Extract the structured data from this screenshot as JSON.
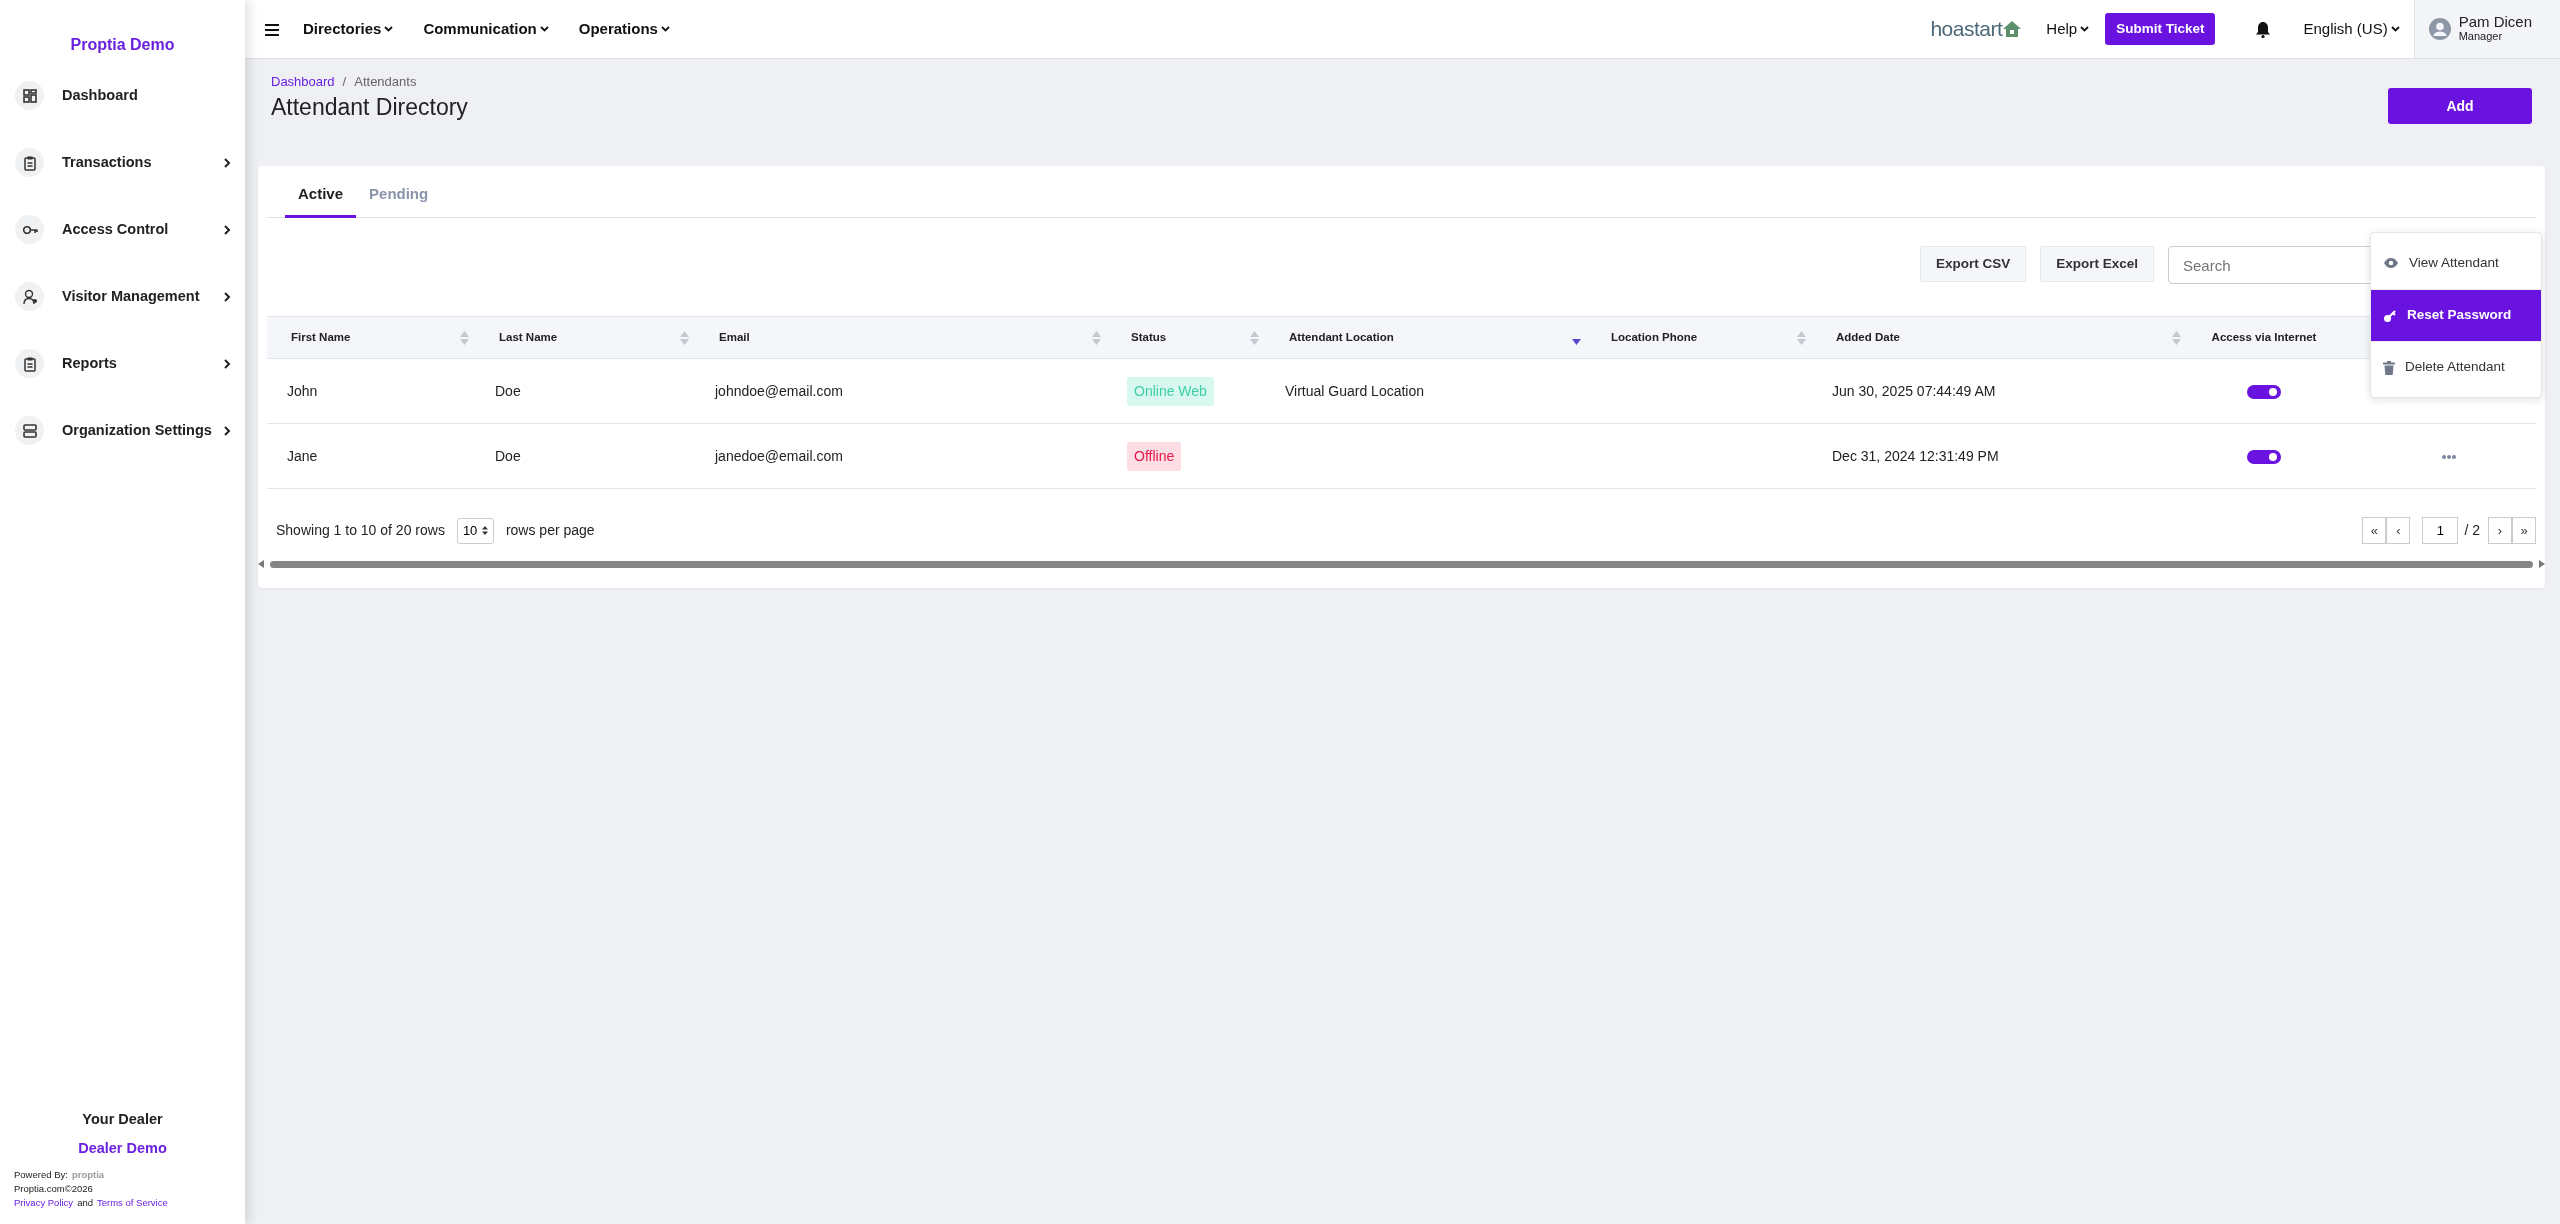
{
  "sidebar": {
    "brand": "Proptia Demo",
    "items": [
      {
        "label": "Dashboard",
        "has_submenu": false
      },
      {
        "label": "Transactions",
        "has_submenu": true
      },
      {
        "label": "Access Control",
        "has_submenu": true
      },
      {
        "label": "Visitor Management",
        "has_submenu": true
      },
      {
        "label": "Reports",
        "has_submenu": true
      },
      {
        "label": "Organization Settings",
        "has_submenu": true
      }
    ],
    "footer": {
      "heading": "Your Dealer",
      "dealer": "Dealer Demo",
      "powered_by": "Powered By:",
      "powered_logo": "proptia",
      "copyright": "Proptia.com©2026",
      "privacy": "Privacy Policy",
      "and": "and",
      "terms": "Terms of Service"
    }
  },
  "topbar": {
    "menus": [
      "Directories",
      "Communication",
      "Operations"
    ],
    "logo": "hoastart",
    "help": "Help",
    "submit_ticket": "Submit Ticket",
    "language": "English (US)",
    "user": {
      "name": "Pam Dicen",
      "role": "Manager"
    }
  },
  "breadcrumb": {
    "items": [
      "Dashboard",
      "Attendants"
    ],
    "separator": "/"
  },
  "title": "Attendant Directory",
  "add_button": "Add",
  "tabs": [
    {
      "label": "Active",
      "selected": true
    },
    {
      "label": "Pending",
      "selected": false
    }
  ],
  "toolbar": {
    "buttons": [
      "Export CSV",
      "Export Excel"
    ],
    "search": {
      "placeholder": "Search"
    }
  },
  "table": {
    "columns": [
      {
        "label": "First Name",
        "sortable": true,
        "sorted": false
      },
      {
        "label": "Last Name",
        "sortable": true,
        "sorted": false
      },
      {
        "label": "Email",
        "sortable": true,
        "sorted": false
      },
      {
        "label": "Status",
        "sortable": true,
        "sorted": false
      },
      {
        "label": "Attendant Location",
        "sortable": true,
        "sorted": true
      },
      {
        "label": "Location Phone",
        "sortable": true,
        "sorted": false
      },
      {
        "label": "Added Date",
        "sortable": true,
        "sorted": false
      },
      {
        "label": "Access via Internet",
        "sortable": false
      }
    ],
    "rows": [
      {
        "first_name": "John",
        "last_name": "Doe",
        "email": "johndoe@email.com",
        "status": {
          "label": "Online Web",
          "kind": "online"
        },
        "location": "Virtual Guard Location",
        "added": "Jun 30, 2025 07:44:49 AM",
        "access": true,
        "menu_open": true
      },
      {
        "first_name": "Jane",
        "last_name": "Doe",
        "email": "janedoe@email.com",
        "status": {
          "label": "Offline",
          "kind": "offline"
        },
        "added": "Dec 31, 2024 12:31:49 PM",
        "access": true,
        "menu_open": false
      }
    ]
  },
  "row_menu": [
    {
      "label": "View Attendant",
      "selected": false
    },
    {
      "label": "Reset Password",
      "selected": true
    },
    {
      "label": "Delete Attendant",
      "selected": false
    }
  ],
  "pagination": {
    "summary": "Showing 1 to 10 of 20 rows",
    "page_size": "10",
    "page_size_label": "rows per page",
    "first": "«",
    "prev": "‹",
    "page": "1",
    "total": "/ 2",
    "next": "›",
    "last": "»"
  }
}
